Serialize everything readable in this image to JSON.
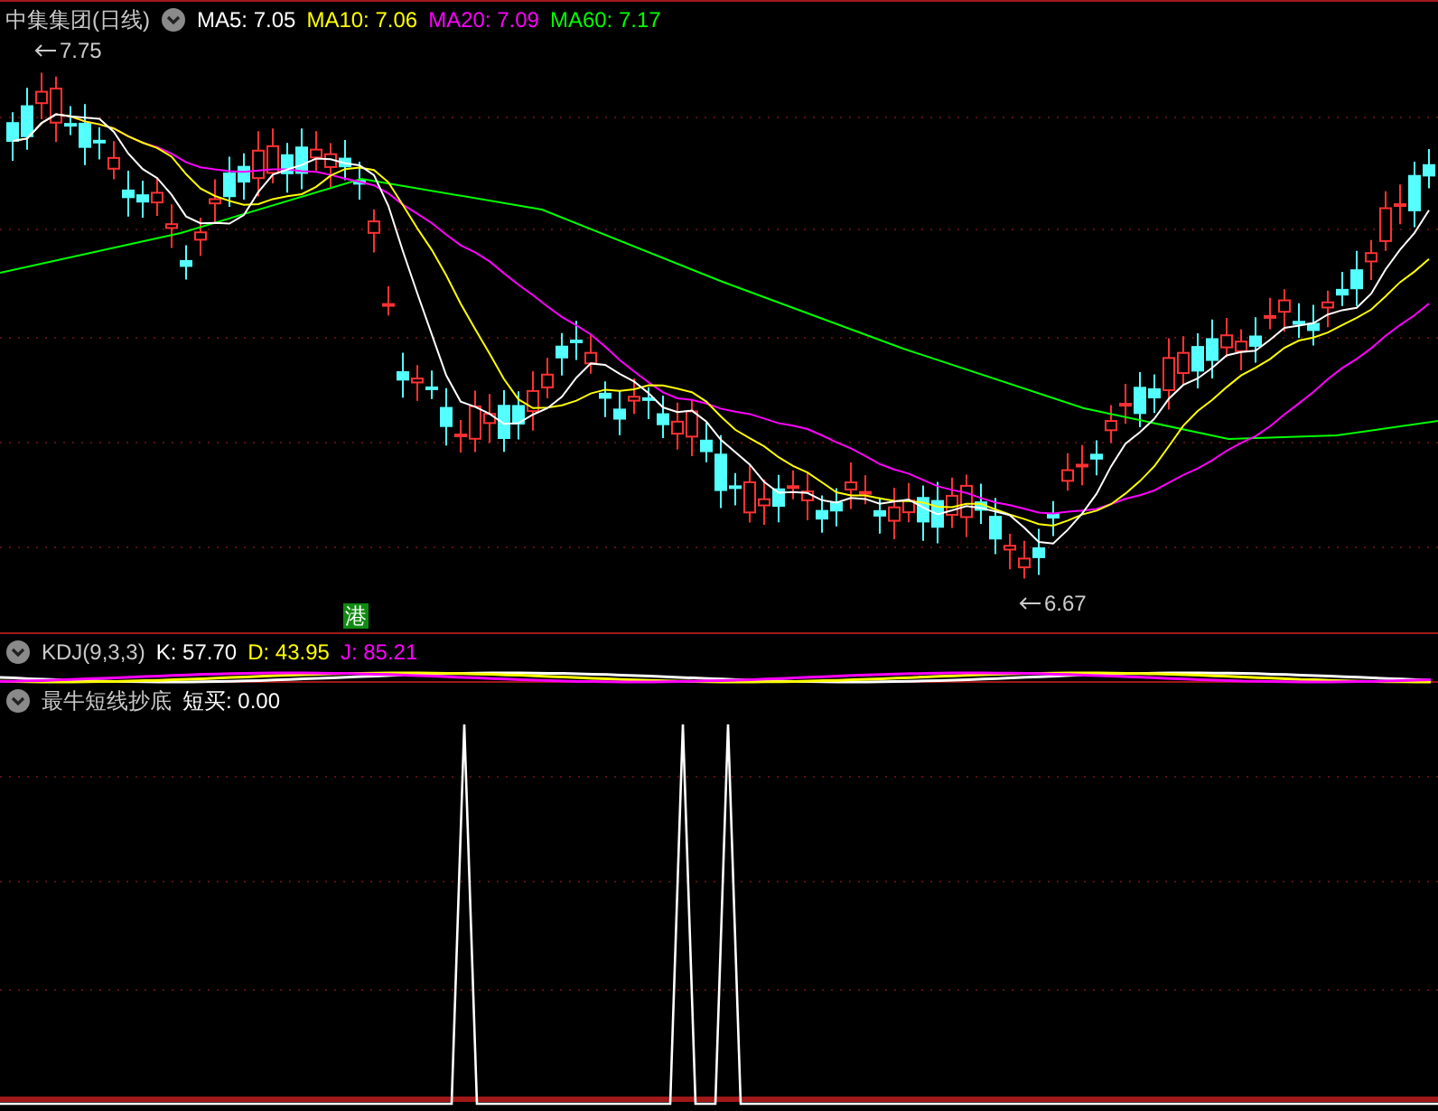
{
  "price_panel": {
    "title": "中集集团(日线)",
    "legend": [
      {
        "label": "MA5: 7.05",
        "color": "#ffffff"
      },
      {
        "label": "MA10: 7.06",
        "color": "#ffff00"
      },
      {
        "label": "MA20: 7.09",
        "color": "#ff00ff"
      },
      {
        "label": "MA60: 7.17",
        "color": "#00ff00"
      }
    ],
    "high_label": "7.75",
    "low_label": "6.67",
    "badge": "港"
  },
  "kdj_panel": {
    "title": "KDJ(9,3,3)",
    "legend": [
      {
        "label": "K: 57.70",
        "color": "#ffffff"
      },
      {
        "label": "D: 43.95",
        "color": "#ffff00"
      },
      {
        "label": "J: 85.21",
        "color": "#ff00ff"
      }
    ]
  },
  "signal_panel": {
    "title": "最牛短线抄底",
    "legend": [
      {
        "label": "短买: 0.00",
        "color": "#ffffff"
      }
    ]
  }
}
